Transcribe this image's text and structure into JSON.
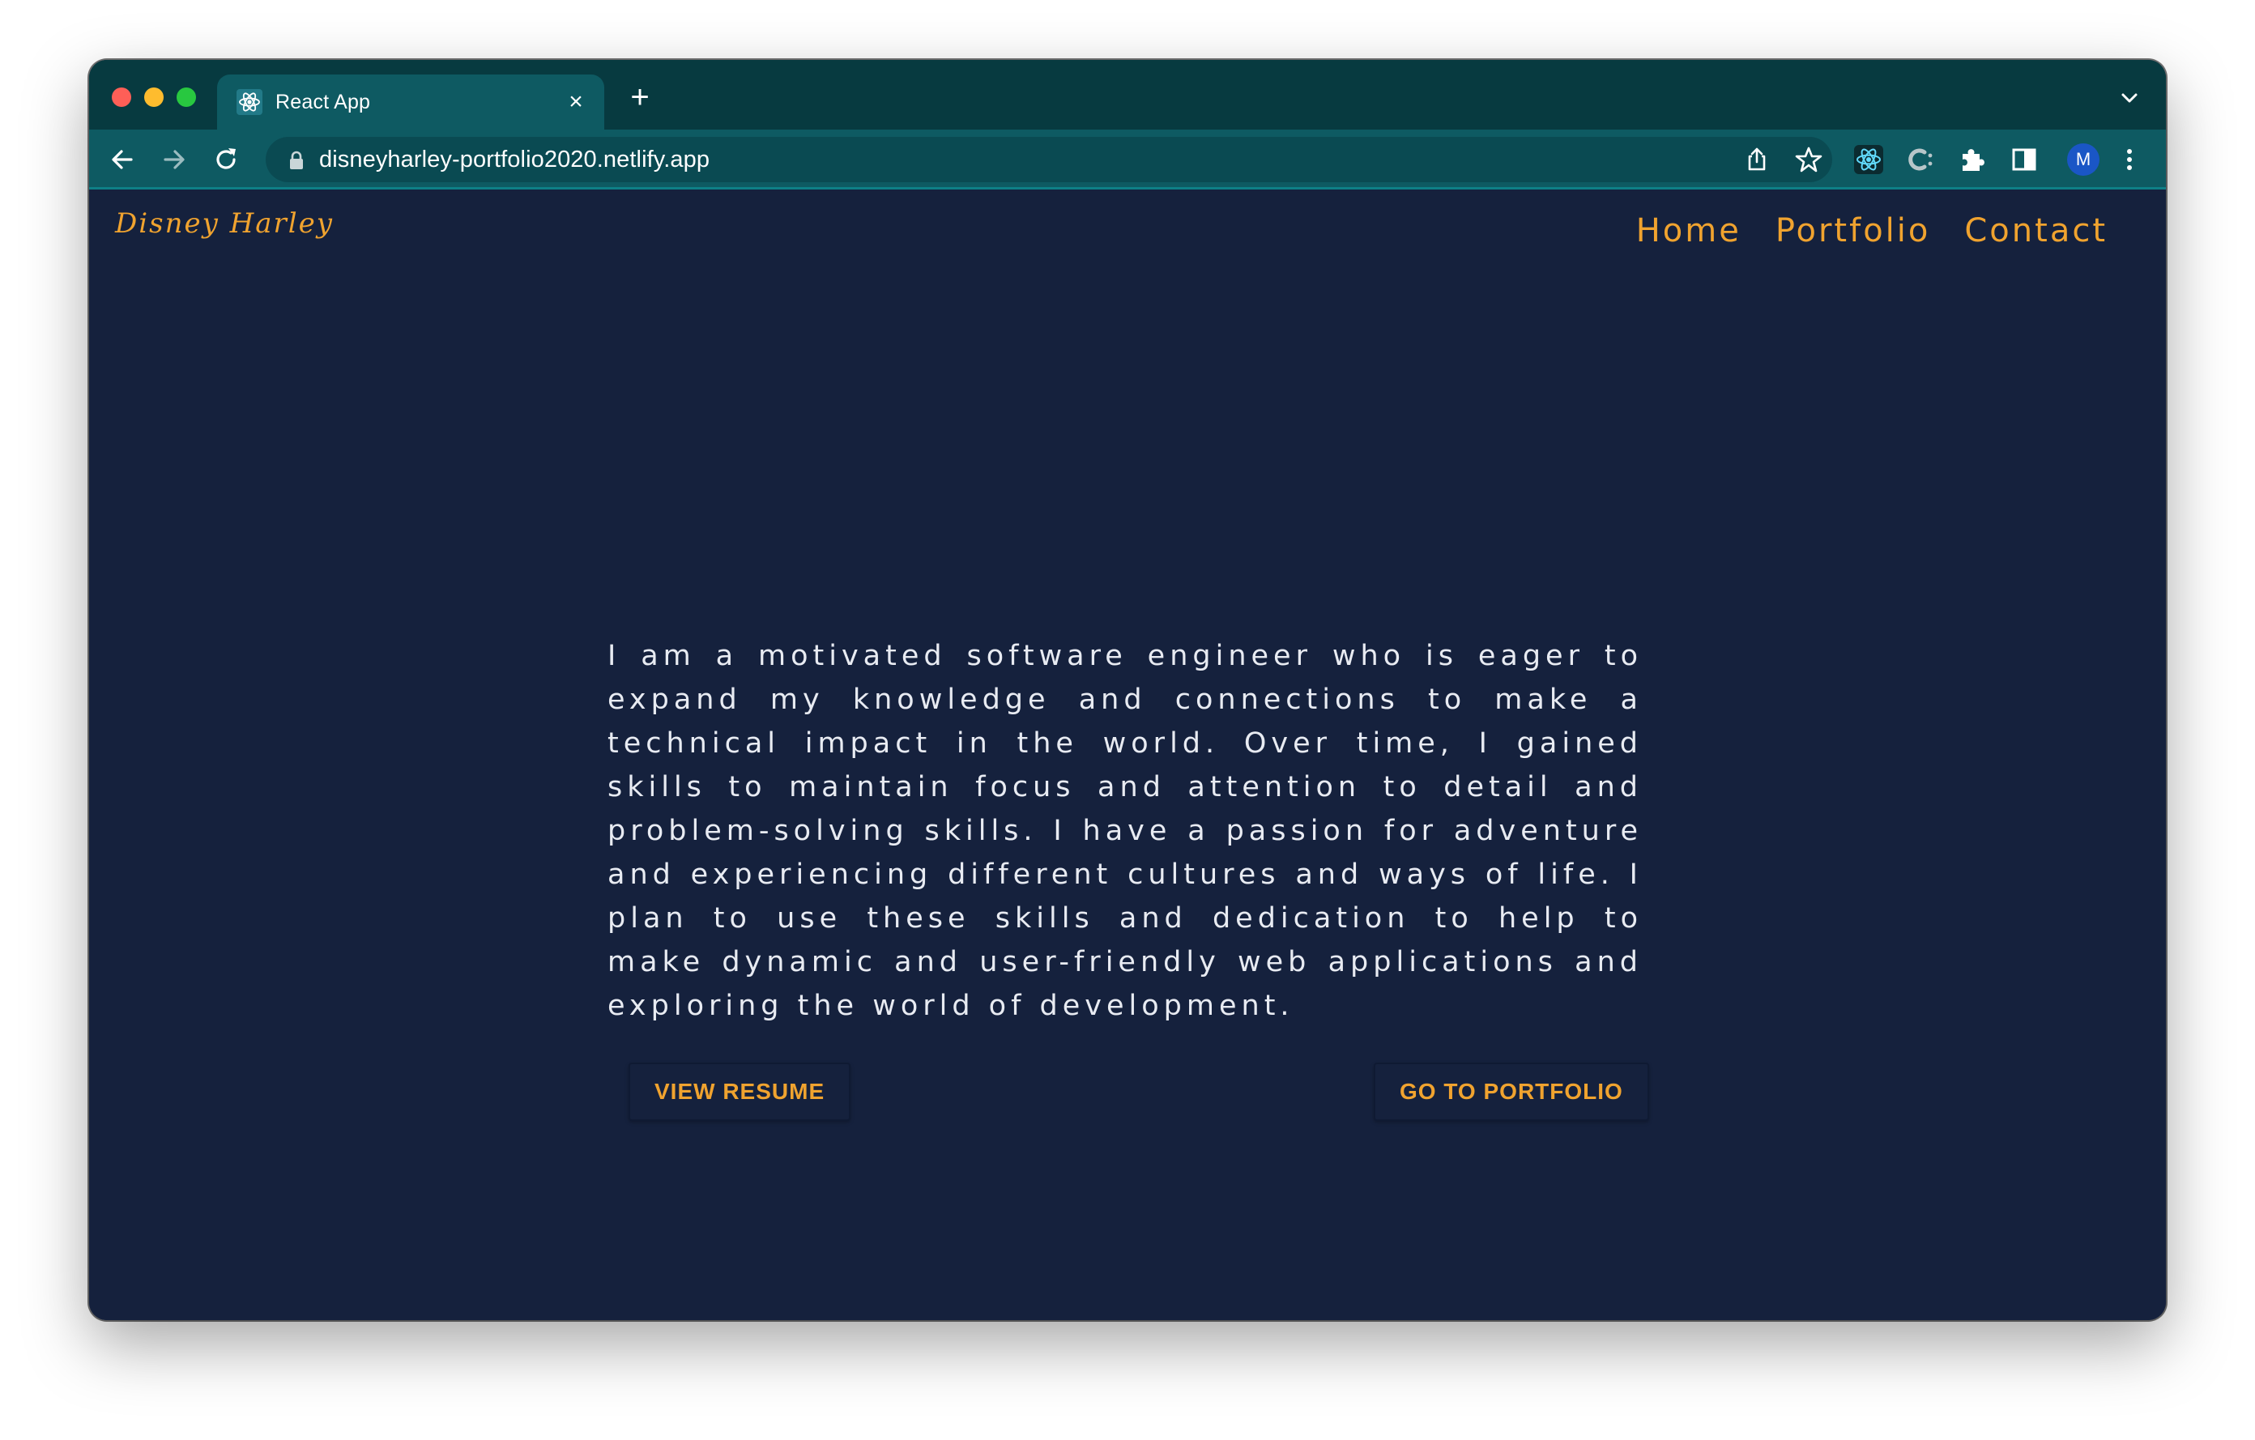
{
  "browser": {
    "tab_title": "React App",
    "tab_close": "×",
    "new_tab": "+",
    "url": "disneyharley-portfolio2020.netlify.app",
    "profile_initial": "M",
    "icons": [
      "react-favicon",
      "back-arrow",
      "forward-arrow",
      "reload",
      "lock",
      "share",
      "star",
      "react-devtools",
      "extension-c",
      "puzzle-piece",
      "side-panel",
      "kebab-menu",
      "chevron-down"
    ]
  },
  "site": {
    "brand": "Disney Harley",
    "nav": [
      "Home",
      "Portfolio",
      "Contact"
    ],
    "about": "I am a motivated software engineer who is eager to expand my knowledge and connections to make a technical impact in the world. Over time, I gained skills to maintain focus and attention to detail and problem-solving skills. I have a passion for adventure and experiencing different cultures and ways of life. I plan to use these skills and dedication to help to make dynamic and user-friendly web applications and exploring the world of development.",
    "buttons": {
      "resume": "VIEW RESUME",
      "portfolio": "GO TO PORTFOLIO"
    }
  },
  "colors": {
    "page_bg": "#15213d",
    "accent": "#f0a32f",
    "tabstrip": "#073a40",
    "toolbar": "#0e5a62",
    "text": "#e8ebf2"
  }
}
